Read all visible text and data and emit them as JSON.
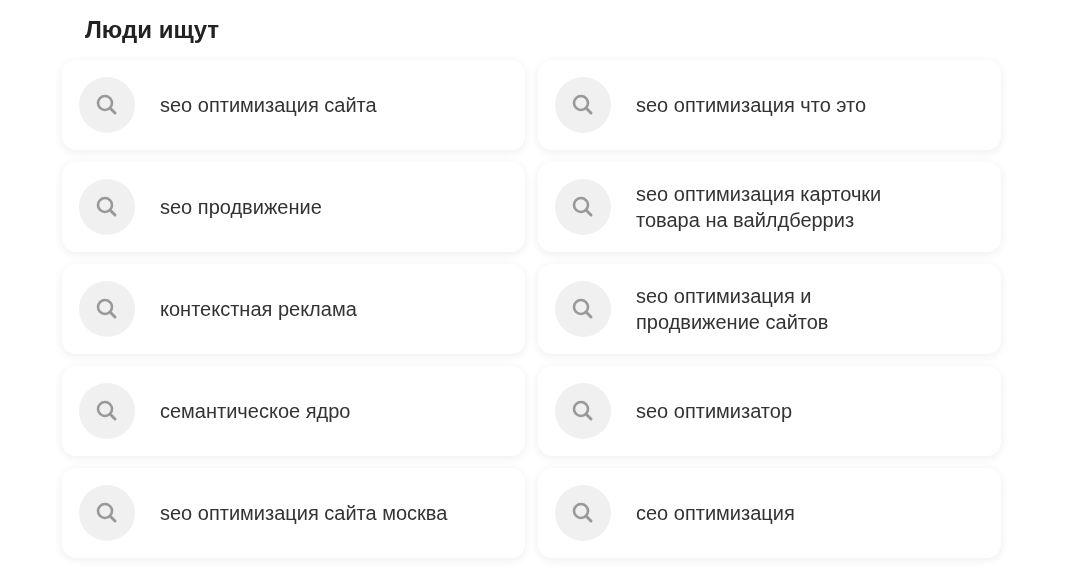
{
  "title": "Люди ищут",
  "suggestions": [
    {
      "text": "seo оптимизация сайта"
    },
    {
      "text": "seo продвижение"
    },
    {
      "text": "контекстная реклама"
    },
    {
      "text": "семантическое ядро"
    },
    {
      "text": "seo оптимизация сайта москва"
    },
    {
      "text": "seo оптимизация что это"
    },
    {
      "text": "seo оптимизация карточки товара на вайлдберриз"
    },
    {
      "text": "seo оптимизация и продвижение сайтов"
    },
    {
      "text": "seo оптимизатор"
    },
    {
      "text": "сео оптимизация"
    }
  ]
}
